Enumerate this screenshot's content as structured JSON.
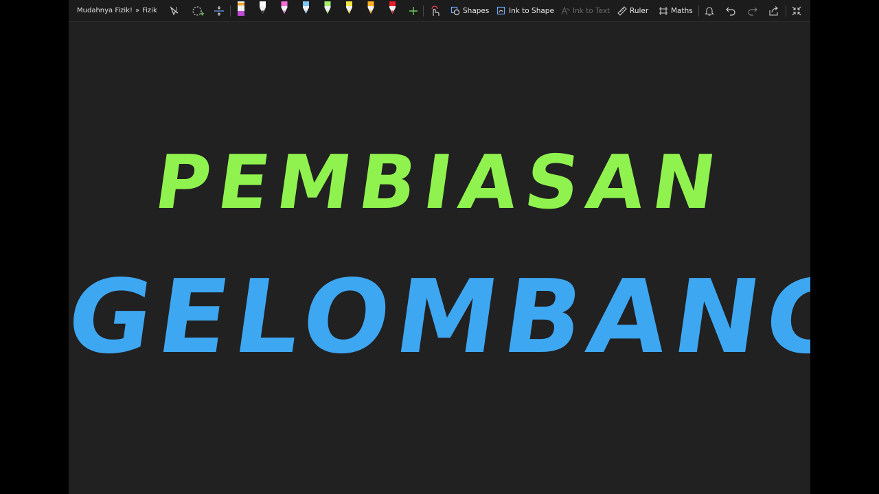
{
  "breadcrumb": {
    "notebook": "Mudahnya Fizik!",
    "separator": "»",
    "section": "Fizik"
  },
  "toolbar": {
    "shapes": "Shapes",
    "ink_to_shape": "Ink to Shape",
    "ink_to_text": "Ink to Text",
    "ruler": "Ruler",
    "maths": "Maths"
  },
  "pens": [
    {
      "name": "pen-magenta-highlighter",
      "color": "#c24bd6"
    },
    {
      "name": "pen-white",
      "color": "#ffffff"
    },
    {
      "name": "pen-pink",
      "color": "#ff6fd8"
    },
    {
      "name": "pen-light-blue",
      "color": "#7ec8ff"
    },
    {
      "name": "pen-light-green",
      "color": "#a6f06a"
    },
    {
      "name": "pen-yellow",
      "color": "#f5e642"
    },
    {
      "name": "pen-orange",
      "color": "#ffb020"
    },
    {
      "name": "pen-red",
      "color": "#e81c2a"
    }
  ],
  "canvas": {
    "line1": "PEMBIASAN",
    "line2": "GELOMBANG",
    "line1_color": "#90f24e",
    "line2_color": "#3ea7f2"
  },
  "colors": {
    "background": "#212121",
    "toolbar": "#1c1c1c",
    "outer": "#000000"
  }
}
